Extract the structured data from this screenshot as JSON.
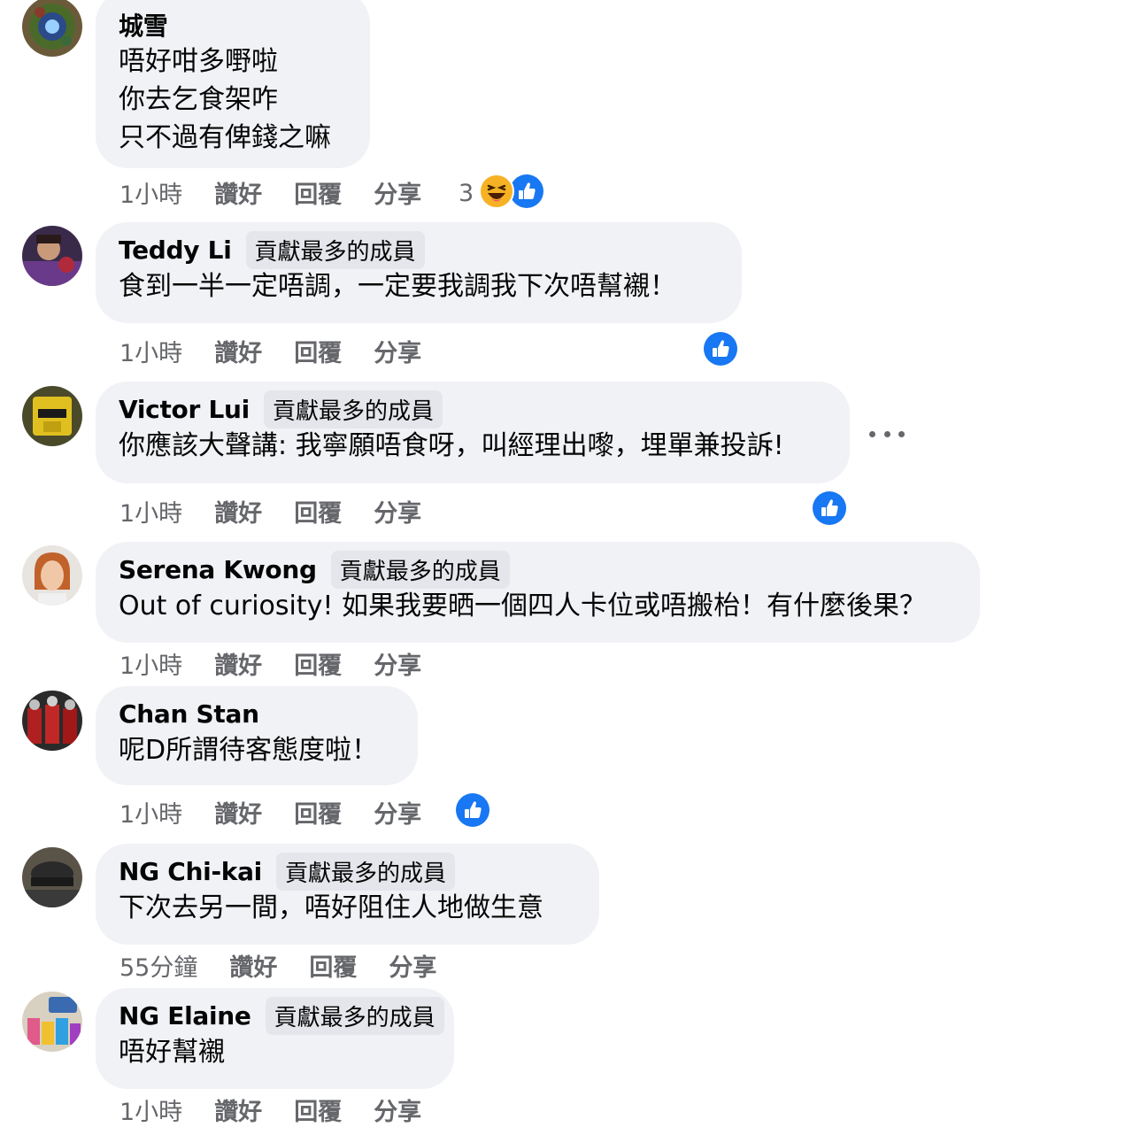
{
  "comments": [
    {
      "name": "城雪",
      "badge": "",
      "lines": [
        "唔好咁多嘢啦",
        "你去乞食架咋",
        "只不過有俾錢之嘛"
      ],
      "time": "1小時",
      "like": "讚好",
      "reply": "回覆",
      "share": "分享",
      "reaction_count": "3",
      "reactions": [
        "haha-icon",
        "like-icon"
      ]
    },
    {
      "name": "Teddy Li",
      "badge": "貢獻最多的成員",
      "lines": [
        "食到一半一定唔調，一定要我調我下次唔幫襯！"
      ],
      "time": "1小時",
      "like": "讚好",
      "reply": "回覆",
      "share": "分享",
      "reactions": [
        "like-icon"
      ]
    },
    {
      "name": "Victor Lui",
      "badge": "貢獻最多的成員",
      "lines": [
        "你應該大聲講: 我寧願唔食呀，叫經理出嚟，埋單兼投訴!"
      ],
      "time": "1小時",
      "like": "讚好",
      "reply": "回覆",
      "share": "分享",
      "reactions": [
        "like-icon"
      ]
    },
    {
      "name": "Serena Kwong",
      "badge": "貢獻最多的成員",
      "lines": [
        "Out of curiosity! 如果我要晒一個四人卡位或唔搬枱！有什麼後果？"
      ],
      "time": "1小時",
      "like": "讚好",
      "reply": "回覆",
      "share": "分享",
      "reactions": []
    },
    {
      "name": "Chan Stan",
      "badge": "",
      "lines": [
        "呢D所謂待客態度啦！"
      ],
      "time": "1小時",
      "like": "讚好",
      "reply": "回覆",
      "share": "分享",
      "reactions": [
        "like-icon"
      ]
    },
    {
      "name": "NG Chi-kai",
      "badge": "貢獻最多的成員",
      "lines": [
        "下次去另一間，唔好阻住人地做生意"
      ],
      "time": "55分鐘",
      "like": "讚好",
      "reply": "回覆",
      "share": "分享",
      "reactions": []
    },
    {
      "name": "NG Elaine",
      "badge": "貢獻最多的成員",
      "lines": [
        "唔好幫襯"
      ],
      "time": "1小時",
      "like": "讚好",
      "reply": "回覆",
      "share": "分享",
      "reactions": []
    }
  ],
  "colors": {
    "bubble": "#f0f2f5",
    "badge": "#e4e6eb",
    "meta_text": "#65676b",
    "like_blue": "#1877f2"
  }
}
